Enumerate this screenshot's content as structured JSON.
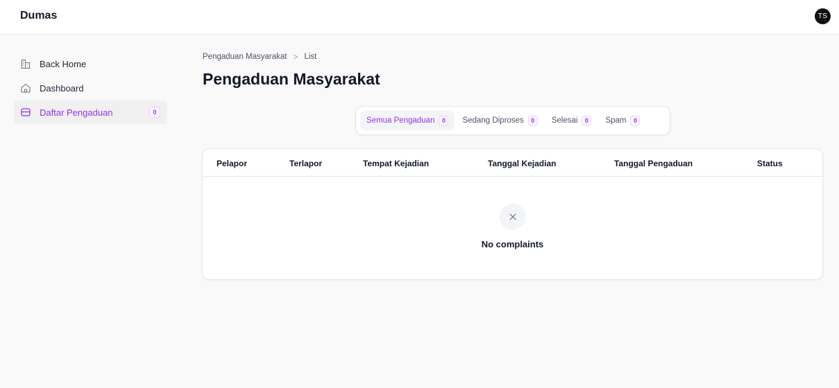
{
  "app": {
    "brand": "Dumas",
    "avatar_initials": "TS"
  },
  "sidebar": {
    "items": [
      {
        "label": "Back Home",
        "icon": "building-icon"
      },
      {
        "label": "Dashboard",
        "icon": "house-icon"
      },
      {
        "label": "Daftar Pengaduan",
        "icon": "inbox-icon",
        "badge": "0",
        "active": true
      }
    ]
  },
  "breadcrumb": {
    "parent": "Pengaduan Masyarakat",
    "current": "List"
  },
  "page": {
    "title": "Pengaduan Masyarakat"
  },
  "tabs": [
    {
      "label": "Semua Pengaduan",
      "count": "0",
      "active": true
    },
    {
      "label": "Sedang Diproses",
      "count": "0"
    },
    {
      "label": "Selesai",
      "count": "0"
    },
    {
      "label": "Spam",
      "count": "0"
    }
  ],
  "table": {
    "columns": [
      "Pelapor",
      "Terlapor",
      "Tempat Kejadian",
      "Tanggal Kejadian",
      "Tanggal Pengaduan",
      "Status"
    ],
    "empty_message": "No complaints"
  },
  "colors": {
    "accent": "#9333ea",
    "background": "#f9f9f9",
    "avatar": "#111111"
  }
}
